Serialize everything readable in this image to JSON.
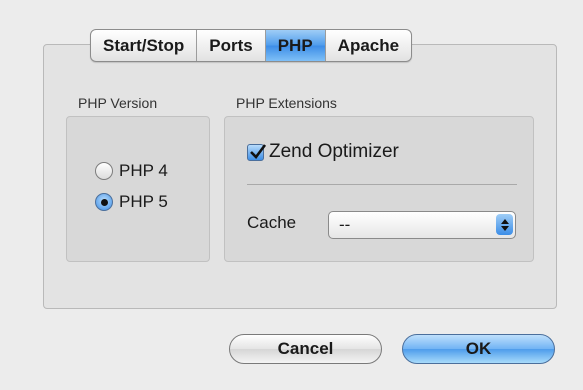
{
  "tabs": [
    {
      "label": "Start/Stop",
      "active": false
    },
    {
      "label": "Ports",
      "active": false
    },
    {
      "label": "PHP",
      "active": true
    },
    {
      "label": "Apache",
      "active": false
    }
  ],
  "php_version": {
    "label": "PHP Version",
    "options": [
      {
        "label": "PHP 4",
        "selected": false
      },
      {
        "label": "PHP 5",
        "selected": true
      }
    ]
  },
  "php_extensions": {
    "label": "PHP Extensions",
    "zend_optimizer": {
      "label": "Zend Optimizer",
      "checked": true
    },
    "cache": {
      "label": "Cache",
      "value": "--"
    }
  },
  "buttons": {
    "cancel": "Cancel",
    "ok": "OK"
  },
  "colors": {
    "accent": "#3c8de7",
    "window_bg": "#ececec"
  }
}
